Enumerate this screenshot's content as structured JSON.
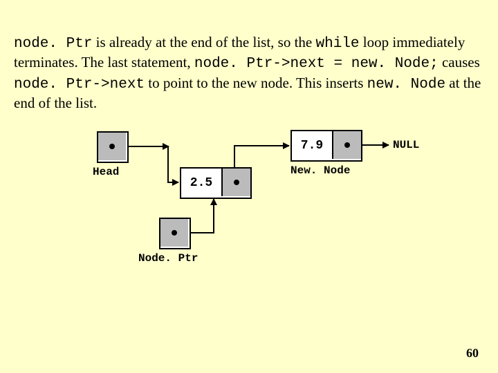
{
  "paragraph": {
    "t1": "node. Ptr",
    "t2": " is already at the end of the list, so the ",
    "t3": "while",
    "t4": " loop immediately terminates. The last statement, ",
    "t5": "node. Ptr->next = new. Node;",
    "t6": " causes ",
    "t7": "node. Ptr->next",
    "t8": " to point to the new node. This inserts ",
    "t9": "new. Node",
    "t10": " at the end of the list."
  },
  "diagram": {
    "head_label": "Head",
    "nodeptr_label": "Node. Ptr",
    "newnode_label": "New. Node",
    "null_label": "NULL",
    "val1": "2.5",
    "val2": "7.9"
  },
  "page": "60"
}
